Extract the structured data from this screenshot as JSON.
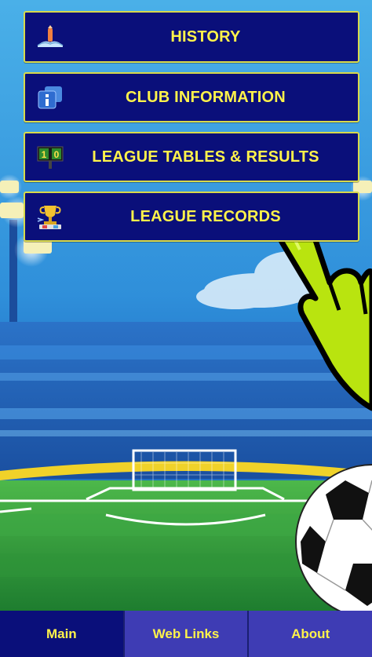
{
  "menu": {
    "items": [
      {
        "label": "HISTORY",
        "icon": "history-book-icon"
      },
      {
        "label": "CLUB INFORMATION",
        "icon": "info-icon"
      },
      {
        "label": "LEAGUE TABLES & RESULTS",
        "icon": "scoreboard-icon"
      },
      {
        "label": "LEAGUE RECORDS",
        "icon": "trophy-icon"
      }
    ],
    "scoreboard_text": "1 0"
  },
  "navbar": {
    "tabs": [
      {
        "label": "Main",
        "active": true
      },
      {
        "label": "Web Links",
        "active": false
      },
      {
        "label": "About",
        "active": false
      }
    ]
  },
  "colors": {
    "button_bg": "#0a0f7a",
    "button_border": "#d8d94a",
    "button_text": "#fff34a",
    "nav_inactive": "#3e3cb4",
    "hand": "#b9e40f"
  }
}
